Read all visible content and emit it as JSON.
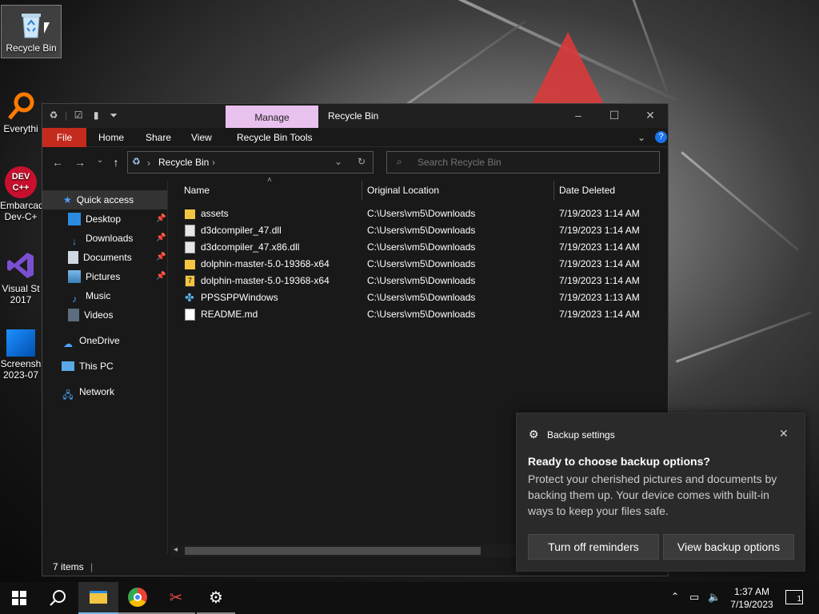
{
  "desktop": {
    "icons": [
      {
        "label": "Recycle Bin",
        "icon": "recycle-bin-icon"
      },
      {
        "label": "Everythi",
        "icon": "everything-search-icon"
      },
      {
        "label": "Embarcad",
        "label2": "Dev-C+",
        "icon": "devcpp-icon",
        "logo_text": "DEV C++"
      },
      {
        "label": "Visual St",
        "label2": "2017",
        "icon": "visual-studio-icon"
      },
      {
        "label": "Screensh",
        "label2": "2023-07",
        "icon": "screenshot-file-icon"
      }
    ]
  },
  "explorer": {
    "qat_icons": [
      "recycle-bin-small-icon",
      "properties-check-icon",
      "blank-page-icon",
      "qat-dropdown-icon"
    ],
    "manage_tab": "Manage",
    "title": "Recycle Bin",
    "ribbon_tabs": [
      "File",
      "Home",
      "Share",
      "View",
      "Recycle Bin Tools"
    ],
    "address": {
      "location": "Recycle Bin"
    },
    "search": {
      "placeholder": "Search Recycle Bin"
    },
    "nav": {
      "quick_access": "Quick access",
      "items": [
        {
          "label": "Desktop",
          "icon": "desktop-folder-icon",
          "pinned": true
        },
        {
          "label": "Downloads",
          "icon": "downloads-folder-icon",
          "pinned": true
        },
        {
          "label": "Documents",
          "icon": "documents-folder-icon",
          "pinned": true
        },
        {
          "label": "Pictures",
          "icon": "pictures-folder-icon",
          "pinned": true
        },
        {
          "label": "Music",
          "icon": "music-folder-icon",
          "pinned": false
        },
        {
          "label": "Videos",
          "icon": "videos-folder-icon",
          "pinned": false
        }
      ],
      "onedrive": "OneDrive",
      "this_pc": "This PC",
      "network": "Network"
    },
    "columns": {
      "name": "Name",
      "original_location": "Original Location",
      "date_deleted": "Date Deleted"
    },
    "files": [
      {
        "name": "assets",
        "location": "C:\\Users\\vm5\\Downloads",
        "date": "7/19/2023 1:14 AM",
        "icon": "folder-icon"
      },
      {
        "name": "d3dcompiler_47.dll",
        "location": "C:\\Users\\vm5\\Downloads",
        "date": "7/19/2023 1:14 AM",
        "icon": "dll-file-icon"
      },
      {
        "name": "d3dcompiler_47.x86.dll",
        "location": "C:\\Users\\vm5\\Downloads",
        "date": "7/19/2023 1:14 AM",
        "icon": "dll-file-icon"
      },
      {
        "name": "dolphin-master-5.0-19368-x64",
        "location": "C:\\Users\\vm5\\Downloads",
        "date": "7/19/2023 1:14 AM",
        "icon": "folder-icon"
      },
      {
        "name": "dolphin-master-5.0-19368-x64",
        "location": "C:\\Users\\vm5\\Downloads",
        "date": "7/19/2023 1:14 AM",
        "icon": "7z-archive-icon"
      },
      {
        "name": "PPSSPPWindows",
        "location": "C:\\Users\\vm5\\Downloads",
        "date": "7/19/2023 1:13 AM",
        "icon": "ppsspp-app-icon"
      },
      {
        "name": "README.md",
        "location": "C:\\Users\\vm5\\Downloads",
        "date": "7/19/2023 1:14 AM",
        "icon": "text-file-icon"
      }
    ],
    "status": {
      "item_count": "7 items"
    }
  },
  "toast": {
    "app": "Backup settings",
    "heading": "Ready to choose backup options?",
    "body": "Protect your cherished pictures and documents by backing them up. Your device comes with built-in ways to keep your files safe.",
    "btn_turn_off": "Turn off reminders",
    "btn_view": "View backup options"
  },
  "taskbar": {
    "apps": [
      "start-icon",
      "search-icon",
      "file-explorer-icon",
      "chrome-icon",
      "snipping-tool-icon",
      "settings-icon"
    ],
    "clock": {
      "time": "1:37 AM",
      "date": "7/19/2023"
    },
    "notification_count": "1"
  },
  "colors": {
    "accent_manage": "#e9c1ee",
    "file_tab": "#c42b1c",
    "folder": "#f4c542",
    "taskbar_active": "#76b9ed"
  }
}
